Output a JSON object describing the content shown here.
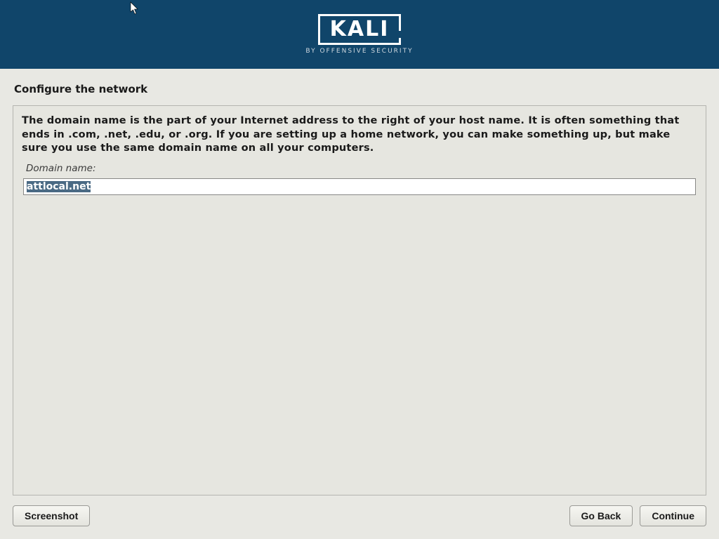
{
  "branding": {
    "logo_text": "KALI",
    "logo_subtitle": "BY OFFENSIVE SECURITY"
  },
  "page": {
    "title": "Configure the network",
    "description": "The domain name is the part of your Internet address to the right of your host name.  It is often something that ends in .com, .net, .edu, or .org.  If you are setting up a home network, you can make something up, but make sure you use the same domain name on all your computers.",
    "field_label": "Domain name:",
    "domain_value": "attlocal.net"
  },
  "buttons": {
    "screenshot": "Screenshot",
    "go_back": "Go Back",
    "continue": "Continue"
  }
}
